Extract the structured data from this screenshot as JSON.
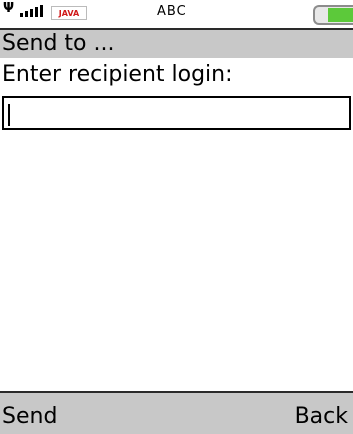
{
  "status": {
    "input_mode": "ABC",
    "java_badge": "JAVA",
    "battery_level": 0.65,
    "colors": {
      "battery_fill": "#5cc93a",
      "java_badge_text": "#d01818"
    }
  },
  "header": {
    "title": "Send to ..."
  },
  "form": {
    "label": "Enter recipient login:",
    "input_value": ""
  },
  "softkeys": {
    "left": "Send",
    "right": "Back"
  }
}
